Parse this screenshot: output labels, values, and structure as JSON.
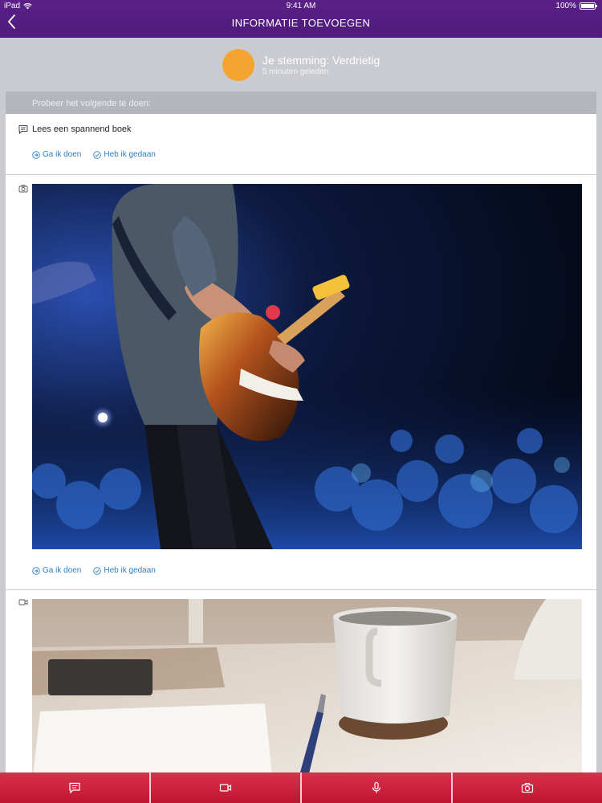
{
  "status": {
    "carrier": "iPad",
    "time": "9:41 AM",
    "battery": "100%"
  },
  "nav": {
    "title": "INFORMATIE TOEVOEGEN"
  },
  "mood": {
    "title": "Je stemming: Verdrietig",
    "subtitle": "5 minuten geleden",
    "color": "#f4a531"
  },
  "try": {
    "label": "Probeer het volgende te doen:"
  },
  "cards": [
    {
      "type": "text",
      "icon": "message-icon",
      "text": "Lees een spannend boek",
      "actions": [
        "Ga ik doen",
        "Heb ik gedaan"
      ]
    },
    {
      "type": "photo",
      "icon": "camera-icon",
      "image": "guitarist-on-stage",
      "actions": [
        "Ga ik doen",
        "Heb ik gedaan"
      ]
    },
    {
      "type": "video",
      "icon": "video-icon",
      "image": "coffee-mug-and-pen-on-desk"
    }
  ],
  "tabbar": {
    "items": [
      "message-icon",
      "video-icon",
      "microphone-icon",
      "camera-icon"
    ]
  },
  "colors": {
    "header": "#521c80",
    "accent": "#c8163a",
    "link": "#2b7fc5"
  }
}
